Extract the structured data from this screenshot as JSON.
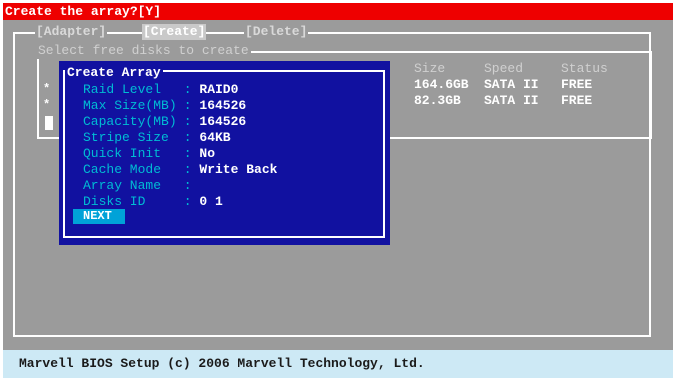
{
  "prompt": "Create the array?[Y]",
  "tabs": [
    "[Adapter]",
    "[Create]",
    "[Delete]"
  ],
  "disk_panel_title": "Select free disks to create",
  "disk_columns": [
    "Size",
    "Speed",
    "Status"
  ],
  "disks": [
    {
      "marker": "*",
      "size": "164.6GB",
      "speed": "SATA II",
      "status": "FREE"
    },
    {
      "marker": "*",
      "size": "82.3GB",
      "speed": "SATA II",
      "status": "FREE"
    }
  ],
  "dialog": {
    "title": "Create Array",
    "fields": [
      {
        "label": "Raid Level",
        "value": "RAID0"
      },
      {
        "label": "Max Size(MB)",
        "value": "164526"
      },
      {
        "label": "Capacity(MB)",
        "value": "164526"
      },
      {
        "label": "Stripe Size",
        "value": "64KB"
      },
      {
        "label": "Quick Init",
        "value": "No"
      },
      {
        "label": "Cache Mode",
        "value": "Write Back"
      },
      {
        "label": "Array Name",
        "value": ""
      },
      {
        "label": "Disks ID",
        "value": "0 1"
      }
    ],
    "next_label": "NEXT"
  },
  "footer": "Marvell BIOS Setup (c) 2006 Marvell Technology, Ltd.",
  "colors": {
    "title_bar": "#ee0000",
    "background": "#9b9b9b",
    "dialog": "#1111a0",
    "label": "#00bcd4",
    "footer": "#cde9f5"
  }
}
